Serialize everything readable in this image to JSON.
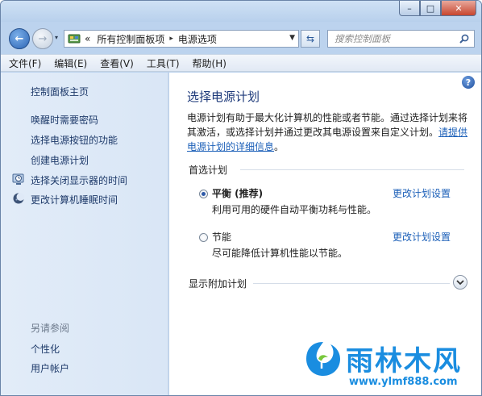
{
  "window": {
    "controls": {
      "minimize": "–",
      "maximize": "□",
      "close": "✕"
    }
  },
  "navigation": {
    "back_glyph": "←",
    "forward_glyph": "→",
    "recent_glyph": "▾",
    "address": {
      "prefix": "«",
      "segments": [
        "所有控制面板项",
        "电源选项"
      ],
      "separator_glyph": "▸",
      "dropdown_glyph": "▼"
    },
    "refresh_glyph": "⇆",
    "search_placeholder": "搜索控制面板"
  },
  "menubar": {
    "items": [
      "文件(F)",
      "编辑(E)",
      "查看(V)",
      "工具(T)",
      "帮助(H)"
    ]
  },
  "sidebar": {
    "home_link": "控制面板主页",
    "links": [
      {
        "label": "唤醒时需要密码",
        "icon": "none"
      },
      {
        "label": "选择电源按钮的功能",
        "icon": "none"
      },
      {
        "label": "创建电源计划",
        "icon": "none"
      },
      {
        "label": "选择关闭显示器的时间",
        "icon": "monitor-clock-icon"
      },
      {
        "label": "更改计算机睡眠时间",
        "icon": "moon-icon"
      }
    ],
    "see_also_label": "另请参阅",
    "see_also_links": [
      "个性化",
      "用户帐户"
    ]
  },
  "content": {
    "help_glyph": "?",
    "title": "选择电源计划",
    "intro_text": "电源计划有助于最大化计算机的性能或者节能。通过选择计划来将其激活，或选择计划并通过更改其电源设置来自定义计划。",
    "intro_link": "请提供电源计划的详细信息",
    "intro_end": "。",
    "preferred_group_title": "首选计划",
    "plans": [
      {
        "name": "平衡 (推荐)",
        "description": "利用可用的硬件自动平衡功耗与性能。",
        "link": "更改计划设置",
        "selected": true
      },
      {
        "name": "节能",
        "description": "尽可能降低计算机性能以节能。",
        "link": "更改计划设置",
        "selected": false
      }
    ],
    "additional_group_title": "显示附加计划"
  },
  "watermark": {
    "text": "雨林木风",
    "url": "www.ylmf888.com"
  },
  "colors": {
    "link": "#1b5fb8",
    "title": "#1e3a7a",
    "sidebar_bg": "#dfe9f7",
    "watermark": "#1a8de0"
  }
}
